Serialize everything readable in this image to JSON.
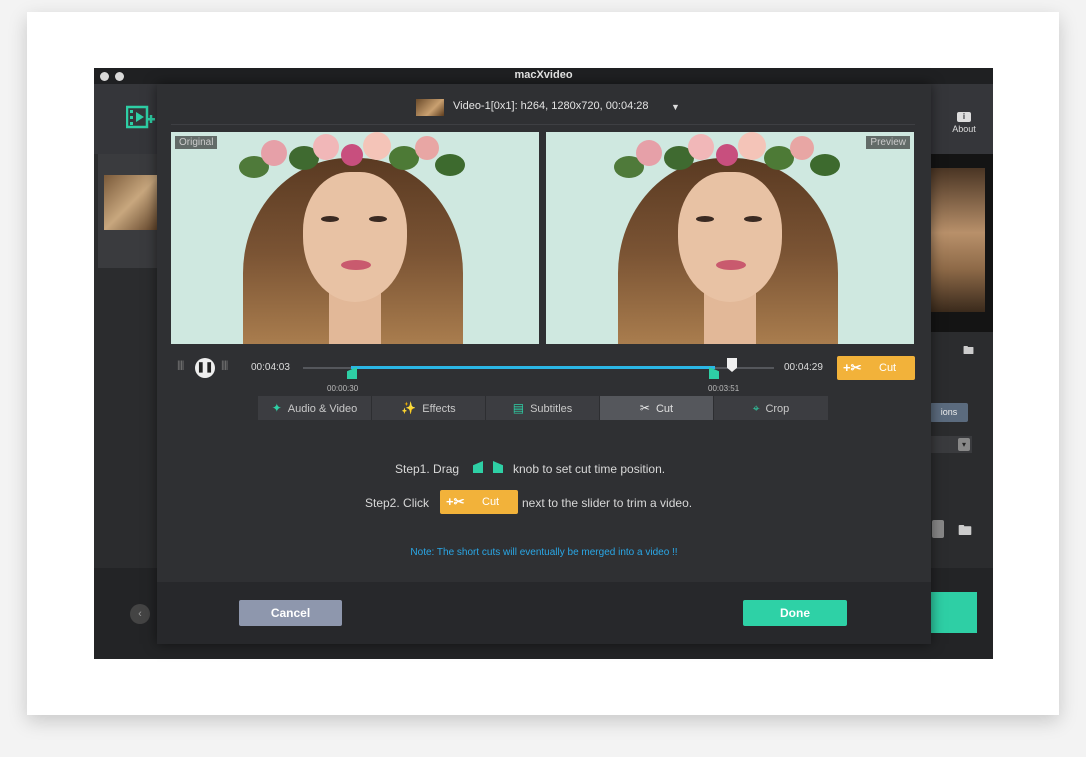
{
  "window": {
    "title": "macXvideo"
  },
  "toolbar": {
    "about_label": "About"
  },
  "background": {
    "options_label": "ions"
  },
  "dialog": {
    "video_info": "Video-1[0x1]: h264, 1280x720, 00:04:28",
    "original_label": "Original",
    "preview_label": "Preview",
    "time_current": "00:04:03",
    "time_end": "00:04:29",
    "trim_start": "00:00:30",
    "trim_end": "00:03:51",
    "trim_start_fraction": 0.1,
    "trim_end_fraction": 0.87,
    "playhead_fraction": 0.9,
    "cut_label": "Cut",
    "tabs": [
      {
        "label": "Audio & Video",
        "icon": "wand-icon"
      },
      {
        "label": "Effects",
        "icon": "sparkle-icon"
      },
      {
        "label": "Subtitles",
        "icon": "subtitle-icon"
      },
      {
        "label": "Cut",
        "icon": "scissors-icon"
      },
      {
        "label": "Crop",
        "icon": "crop-icon"
      }
    ],
    "active_tab": "Cut",
    "step1_a": "Step1. Drag",
    "step1_b": "knob to set cut time position.",
    "step2_a": "Step2. Click",
    "step2_b": "next to the slider to trim a video.",
    "note": "Note: The short cuts will eventually be merged into a video !!",
    "cancel_label": "Cancel",
    "done_label": "Done"
  },
  "colors": {
    "accent_green": "#2ecfa5",
    "cut_orange": "#f2b23a",
    "note_blue": "#2aa7e6",
    "cancel": "#8e97ad"
  }
}
